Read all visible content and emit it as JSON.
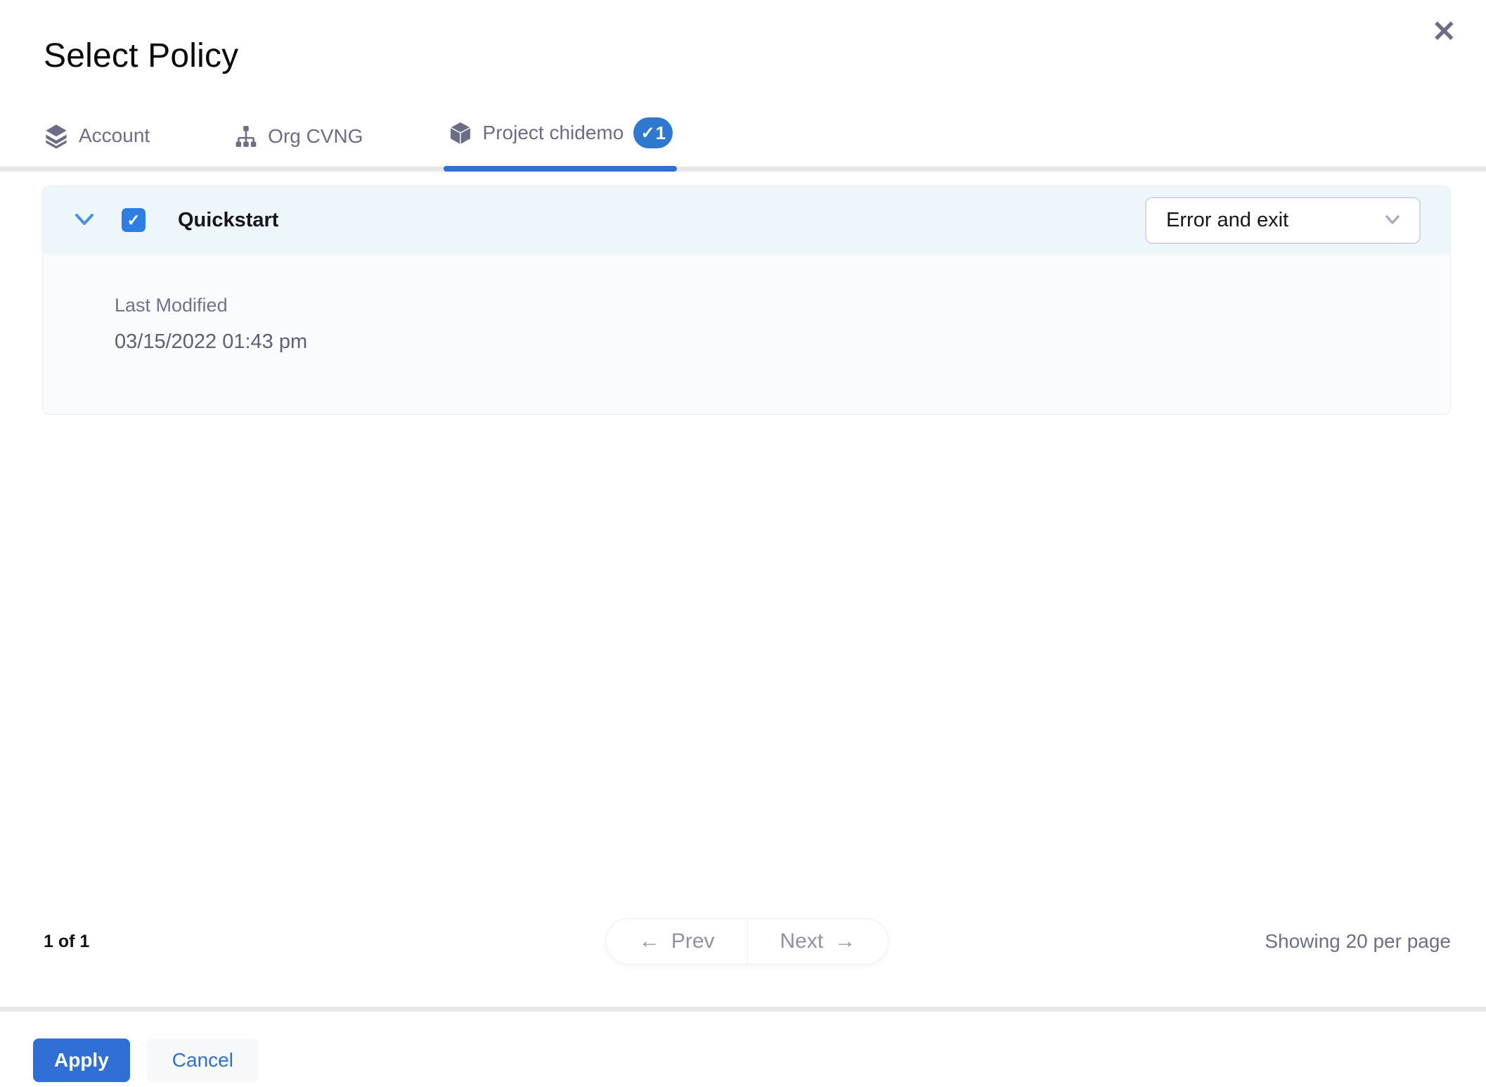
{
  "modal": {
    "title": "Select Policy",
    "close_glyph": "✕"
  },
  "tabs": [
    {
      "label": "Account",
      "icon": "layers-icon",
      "active": false
    },
    {
      "label": "Org CVNG",
      "icon": "org-hierarchy-icon",
      "active": false
    },
    {
      "label": "Project chidemo",
      "icon": "cube-icon",
      "active": true,
      "badge_check": "✓",
      "badge_count": "1"
    }
  ],
  "policy_row": {
    "name": "Quickstart",
    "checked": true,
    "checkbox_glyph": "✓",
    "action_select": {
      "value": "Error and exit"
    },
    "details": {
      "last_modified_label": "Last Modified",
      "last_modified_value": "03/15/2022 01:43 pm"
    }
  },
  "pagination": {
    "page_info": "1 of 1",
    "prev_arrow": "←",
    "prev_label": "Prev",
    "next_label": "Next",
    "next_arrow": "→",
    "showing": "Showing 20 per page"
  },
  "footer": {
    "apply_label": "Apply",
    "cancel_label": "Cancel"
  },
  "colors": {
    "primary_blue": "#2f6fd6",
    "badge_blue": "#2e78d0",
    "checkbox_blue": "#2e7de4",
    "chevron_blue": "#4a90e2",
    "tab_gray": "#6b6d85",
    "muted_gray": "#8f90a6",
    "row_header_bg": "#edf7fb",
    "card_body_bg": "#fafbfc",
    "divider_gray": "#e7e7ea"
  }
}
